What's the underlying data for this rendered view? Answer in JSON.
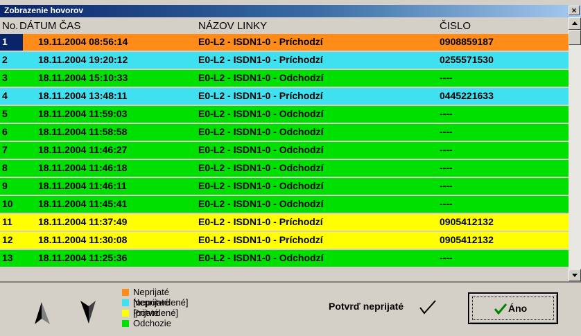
{
  "window": {
    "title": "Zobrazenie hovorov",
    "close_label": "×"
  },
  "columns": {
    "no": "No.",
    "datetime": "DÁTUM ČAS",
    "line": "NÁZOV LINKY",
    "number": "ČISLO"
  },
  "colors": {
    "missed_unconfirmed": "#ff8c19",
    "missed_confirmed": "#3fe0f0",
    "received": "#ffff00",
    "outgoing": "#00e000",
    "selected": "#0a246a"
  },
  "rows": [
    {
      "no": "1",
      "datetime": "19.11.2004 08:56:14",
      "line": "E0-L2 - ISDN1-0 - Príchodzí",
      "number": "0908859187",
      "status": "missed_unconfirmed"
    },
    {
      "no": "2",
      "datetime": "18.11.2004 19:20:12",
      "line": "E0-L2 - ISDN1-0 - Príchodzí",
      "number": "0255571530",
      "status": "missed_confirmed"
    },
    {
      "no": "3",
      "datetime": "18.11.2004 15:10:33",
      "line": "E0-L2 - ISDN1-0 - Odchodzí",
      "number": "----",
      "status": "outgoing"
    },
    {
      "no": "4",
      "datetime": "18.11.2004 13:48:11",
      "line": "E0-L2 - ISDN1-0 - Príchodzí",
      "number": "0445221633",
      "status": "missed_confirmed"
    },
    {
      "no": "5",
      "datetime": "18.11.2004 11:59:03",
      "line": "E0-L2 - ISDN1-0 - Odchodzí",
      "number": "----",
      "status": "outgoing"
    },
    {
      "no": "6",
      "datetime": "18.11.2004 11:58:58",
      "line": "E0-L2 - ISDN1-0 - Odchodzí",
      "number": "----",
      "status": "outgoing"
    },
    {
      "no": "7",
      "datetime": "18.11.2004 11:46:27",
      "line": "E0-L2 - ISDN1-0 - Odchodzí",
      "number": "----",
      "status": "outgoing"
    },
    {
      "no": "8",
      "datetime": "18.11.2004 11:46:18",
      "line": "E0-L2 - ISDN1-0 - Odchodzí",
      "number": "----",
      "status": "outgoing"
    },
    {
      "no": "9",
      "datetime": "18.11.2004 11:46:11",
      "line": "E0-L2 - ISDN1-0 - Odchodzí",
      "number": "----",
      "status": "outgoing"
    },
    {
      "no": "10",
      "datetime": "18.11.2004 11:45:41",
      "line": "E0-L2 - ISDN1-0 - Odchodzí",
      "number": "----",
      "status": "outgoing"
    },
    {
      "no": "11",
      "datetime": "18.11.2004 11:37:49",
      "line": "E0-L2 - ISDN1-0 - Príchodzí",
      "number": "0905412132",
      "status": "received"
    },
    {
      "no": "12",
      "datetime": "18.11.2004 11:30:08",
      "line": "E0-L2 - ISDN1-0 - Príchodzí",
      "number": "0905412132",
      "status": "received"
    },
    {
      "no": "13",
      "datetime": "18.11.2004 11:25:36",
      "line": "E0-L2 - ISDN1-0 - Odchodzí",
      "number": "----",
      "status": "outgoing"
    }
  ],
  "legend": [
    {
      "label": "Neprijaté [nepotvrdené]",
      "status": "missed_unconfirmed"
    },
    {
      "label": "Neprijaté [potvrdené]",
      "status": "missed_confirmed"
    },
    {
      "label": "Prijaté",
      "status": "received"
    },
    {
      "label": "Odchozie",
      "status": "outgoing"
    }
  ],
  "confirm_label": "Potvrď neprijaté",
  "yes_label": "Áno",
  "icons": {
    "up": "arrow-up-icon",
    "down": "arrow-down-icon",
    "check": "checkmark-icon"
  }
}
